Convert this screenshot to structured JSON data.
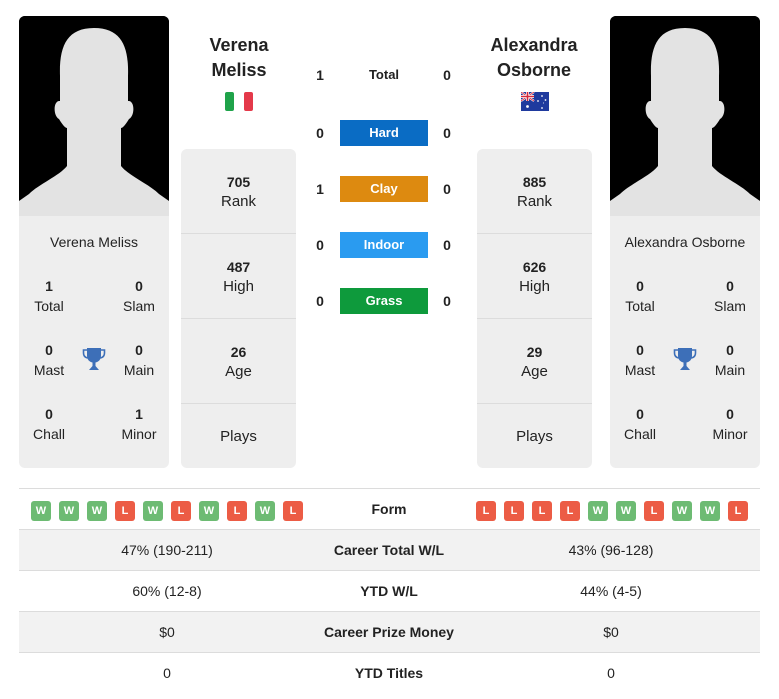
{
  "colors": {
    "hard": "#0a6cc4",
    "clay": "#dd8a10",
    "indoor": "#2a9bf0",
    "grass": "#0e9a3c",
    "win": "#6dbb73",
    "loss": "#ec5c45",
    "trophy": "#3d6fb8"
  },
  "player1": {
    "name_line1": "Verena",
    "name_line2": "Meliss",
    "full_name": "Verena Meliss",
    "flag": "italy-flag",
    "rank": "705",
    "rank_label": "Rank",
    "high": "487",
    "high_label": "High",
    "age": "26",
    "age_label": "Age",
    "plays_label": "Plays",
    "titles": {
      "total": "1",
      "total_label": "Total",
      "slam": "0",
      "slam_label": "Slam",
      "mast": "0",
      "mast_label": "Mast",
      "main": "0",
      "main_label": "Main",
      "chall": "0",
      "chall_label": "Chall",
      "minor": "1",
      "minor_label": "Minor"
    }
  },
  "player2": {
    "name_line1": "Alexandra",
    "name_line2": "Osborne",
    "full_name": "Alexandra Osborne",
    "flag": "australia-flag",
    "rank": "885",
    "rank_label": "Rank",
    "high": "626",
    "high_label": "High",
    "age": "29",
    "age_label": "Age",
    "plays_label": "Plays",
    "titles": {
      "total": "0",
      "total_label": "Total",
      "slam": "0",
      "slam_label": "Slam",
      "mast": "0",
      "mast_label": "Mast",
      "main": "0",
      "main_label": "Main",
      "chall": "0",
      "chall_label": "Chall",
      "minor": "0",
      "minor_label": "Minor"
    }
  },
  "h2h": [
    {
      "label": "Total",
      "p1": "1",
      "p2": "0",
      "kind": "total"
    },
    {
      "label": "Hard",
      "p1": "0",
      "p2": "0",
      "kind": "hard"
    },
    {
      "label": "Clay",
      "p1": "1",
      "p2": "0",
      "kind": "clay"
    },
    {
      "label": "Indoor",
      "p1": "0",
      "p2": "0",
      "kind": "indoor"
    },
    {
      "label": "Grass",
      "p1": "0",
      "p2": "0",
      "kind": "grass"
    }
  ],
  "table": {
    "form_label": "Form",
    "p1_form": [
      "W",
      "W",
      "W",
      "L",
      "W",
      "L",
      "W",
      "L",
      "W",
      "L"
    ],
    "p2_form": [
      "L",
      "L",
      "L",
      "L",
      "W",
      "W",
      "L",
      "W",
      "W",
      "L"
    ],
    "rows": [
      {
        "label": "Career Total W/L",
        "p1": "47% (190-211)",
        "p2": "43% (96-128)"
      },
      {
        "label": "YTD W/L",
        "p1": "60% (12-8)",
        "p2": "44% (4-5)"
      },
      {
        "label": "Career Prize Money",
        "p1": "$0",
        "p2": "$0"
      },
      {
        "label": "YTD Titles",
        "p1": "0",
        "p2": "0"
      }
    ]
  }
}
